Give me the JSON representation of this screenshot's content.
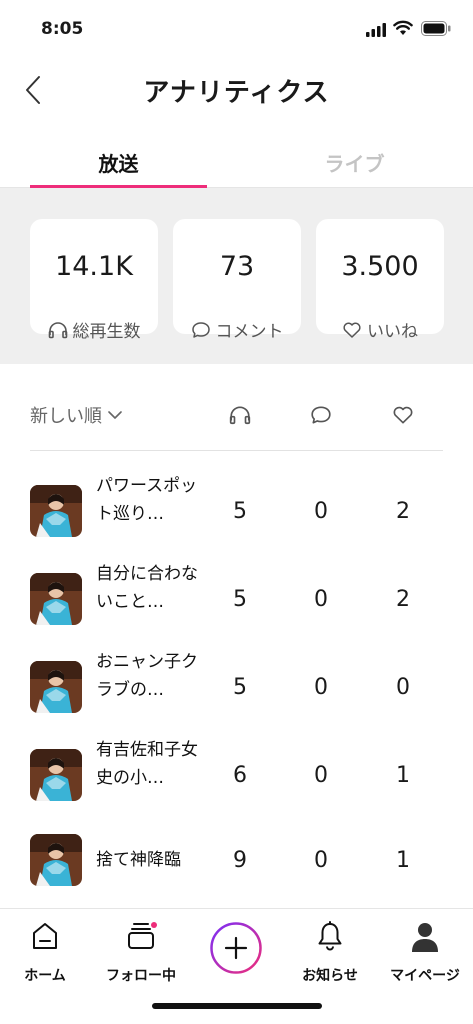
{
  "status_bar": {
    "time": "8:05"
  },
  "header": {
    "title": "アナリティクス"
  },
  "tabs": [
    {
      "label": "放送",
      "active": true
    },
    {
      "label": "ライブ",
      "active": false
    }
  ],
  "stats": [
    {
      "value": "14.1K",
      "label": "総再生数",
      "icon": "headphones-icon"
    },
    {
      "value": "73",
      "label": "コメント",
      "icon": "comment-icon"
    },
    {
      "value": "3.500",
      "label": "いいね",
      "icon": "heart-icon"
    }
  ],
  "sort": {
    "label": "新しい順"
  },
  "items": [
    {
      "title": "パワースポット巡り…",
      "plays": "5",
      "comments": "0",
      "likes": "2"
    },
    {
      "title": "自分に合わないこと…",
      "plays": "5",
      "comments": "0",
      "likes": "2"
    },
    {
      "title": "おニャン子クラブの…",
      "plays": "5",
      "comments": "0",
      "likes": "0"
    },
    {
      "title": "有吉佐和子女史の小…",
      "plays": "6",
      "comments": "0",
      "likes": "1"
    },
    {
      "title": "捨て神降臨",
      "plays": "9",
      "comments": "0",
      "likes": "1"
    }
  ],
  "nav": [
    {
      "label": "ホーム",
      "icon": "home-icon"
    },
    {
      "label": "フォロー中",
      "icon": "following-icon"
    },
    {
      "label": "",
      "icon": "plus-icon"
    },
    {
      "label": "お知らせ",
      "icon": "bell-icon"
    },
    {
      "label": "マイページ",
      "icon": "person-icon"
    }
  ],
  "colors": {
    "accent": "#ee2d7a",
    "create_gradient_start": "#7b2ff7",
    "create_gradient_end": "#ee2d7a"
  }
}
